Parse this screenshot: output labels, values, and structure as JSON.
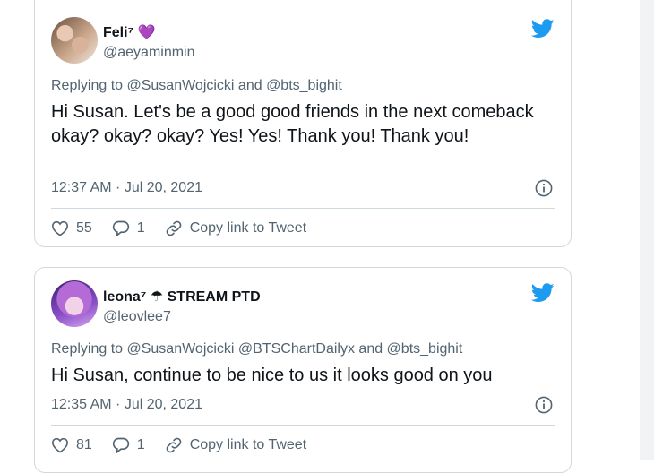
{
  "tweets": [
    {
      "name": "Feli⁷ 💜",
      "handle": "@aeyaminmin",
      "replying": "Replying to @SusanWojcicki and @bts_bighit",
      "text": "Hi Susan. Let's be a good good friends in the next comeback okay? okay? okay? Yes! Yes! Thank you! Thank you!",
      "time": "12:37 AM · Jul 20, 2021",
      "likes": "55",
      "replies": "1",
      "copy_label": "Copy link to Tweet"
    },
    {
      "name": "leona⁷ ☂ STREAM PTD",
      "handle": "@leovlee7",
      "replying": "Replying to @SusanWojcicki @BTSChartDailyx and @bts_bighit",
      "text": "Hi Susan, continue to be nice to us it looks good on you",
      "time": "12:35 AM · Jul 20, 2021",
      "likes": "81",
      "replies": "1",
      "copy_label": "Copy link to Tweet"
    }
  ],
  "colors": {
    "twitter_blue": "#1d9bf0",
    "secondary_text": "#536471",
    "primary_text": "#0f1419",
    "border": "#cfd9de"
  },
  "icons": [
    "twitter-bird-icon",
    "info-icon",
    "heart-icon",
    "reply-icon",
    "link-icon"
  ]
}
